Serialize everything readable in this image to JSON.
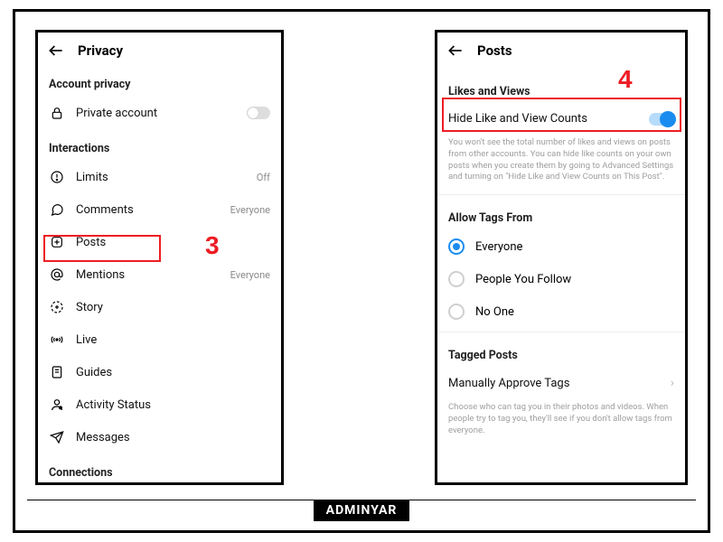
{
  "brand": "ADMINYAR",
  "steps": {
    "three": "3",
    "four": "4"
  },
  "left": {
    "title": "Privacy",
    "section1": "Account privacy",
    "privateAccount": {
      "label": "Private account",
      "on": false
    },
    "section2": "Interactions",
    "items": [
      {
        "icon": "limits-icon",
        "label": "Limits",
        "value": "Off"
      },
      {
        "icon": "comment-icon",
        "label": "Comments",
        "value": "Everyone"
      },
      {
        "icon": "posts-icon",
        "label": "Posts",
        "value": ""
      },
      {
        "icon": "mention-icon",
        "label": "Mentions",
        "value": "Everyone"
      },
      {
        "icon": "story-icon",
        "label": "Story",
        "value": ""
      },
      {
        "icon": "live-icon",
        "label": "Live",
        "value": ""
      },
      {
        "icon": "guides-icon",
        "label": "Guides",
        "value": ""
      },
      {
        "icon": "activity-icon",
        "label": "Activity Status",
        "value": ""
      },
      {
        "icon": "messages-icon",
        "label": "Messages",
        "value": ""
      }
    ],
    "section3": "Connections"
  },
  "right": {
    "title": "Posts",
    "section1": "Likes and Views",
    "hideCounts": {
      "label": "Hide Like and View Counts",
      "on": true
    },
    "hideCountsDesc": "You won't see the total number of likes and views on posts from other accounts. You can hide like counts on your own posts when you create them by going to Advanced Settings and turning on \"Hide Like and View Counts on This Post\".",
    "section2": "Allow Tags From",
    "allowTags": {
      "options": [
        {
          "label": "Everyone",
          "selected": true
        },
        {
          "label": "People You Follow",
          "selected": false
        },
        {
          "label": "No One",
          "selected": false
        }
      ]
    },
    "section3": "Tagged Posts",
    "manualApprove": "Manually Approve Tags",
    "taggedDesc": "Choose who can tag you in their photos and videos. When people try to tag you, they'll see if you don't allow tags from everyone."
  }
}
